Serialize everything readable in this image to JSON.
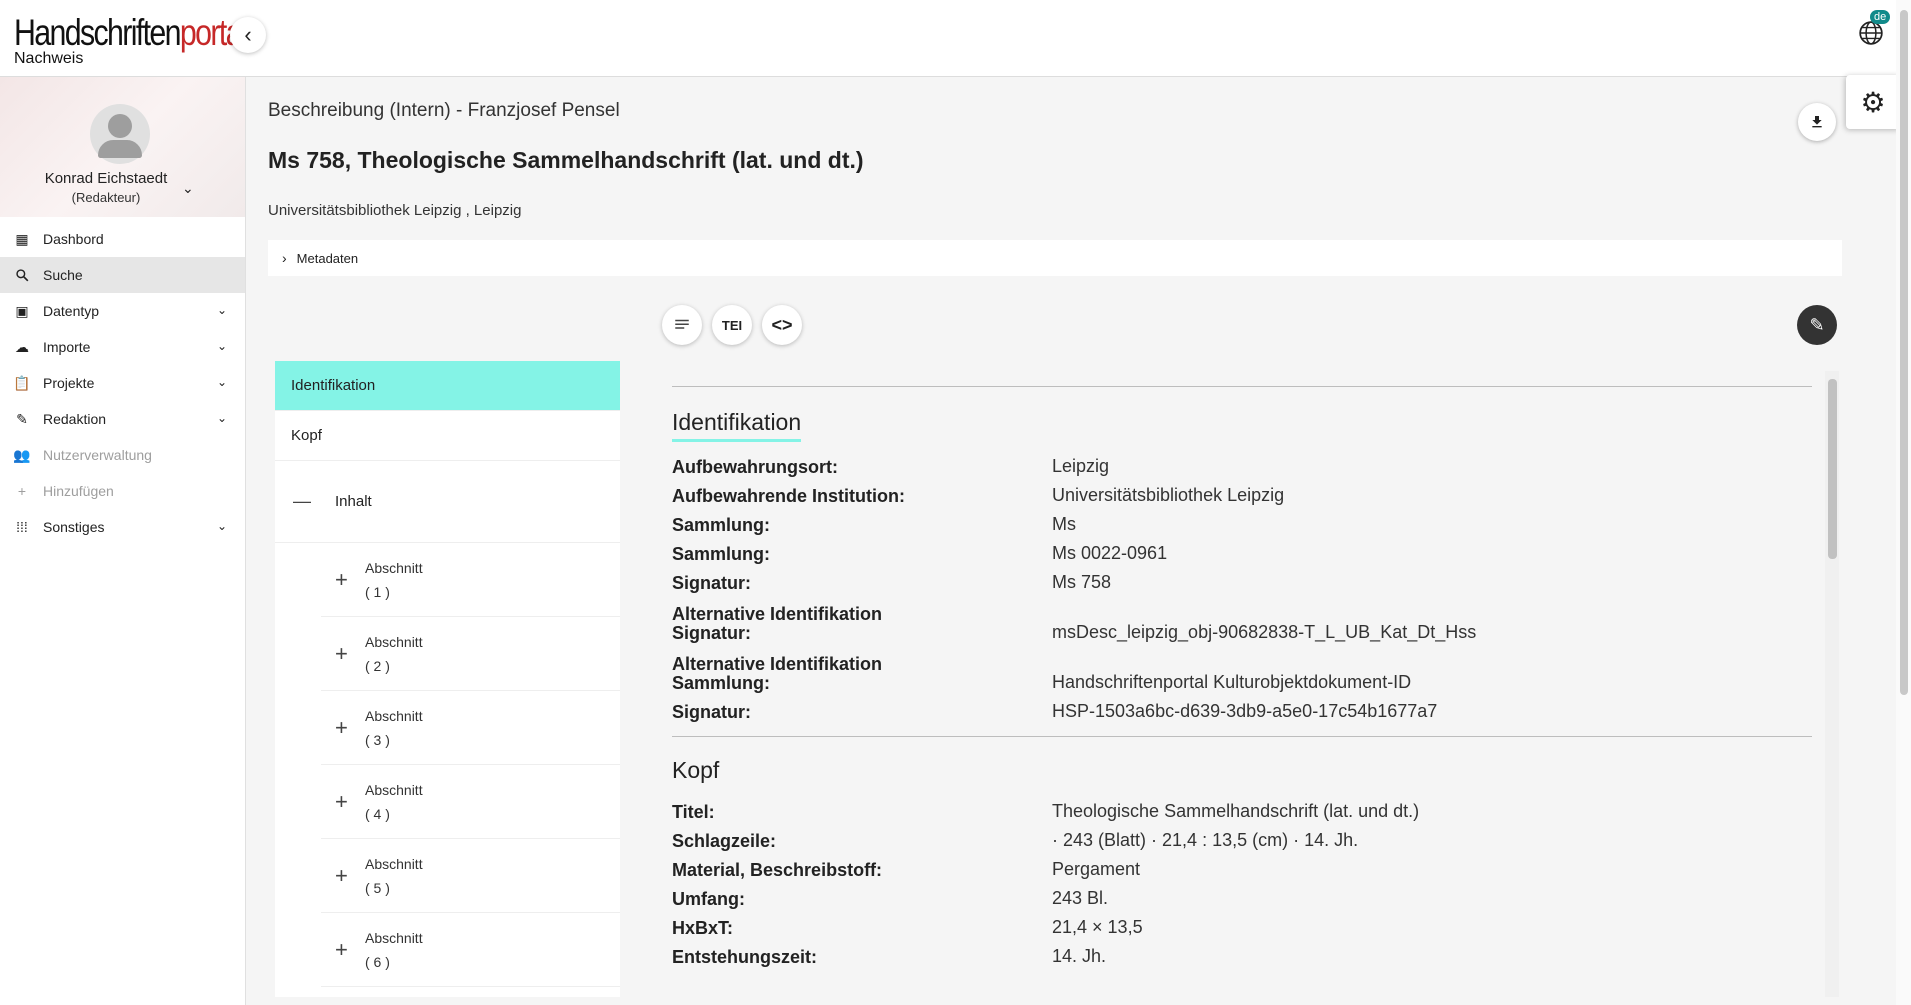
{
  "app": {
    "logo_main_a": "Handschriften",
    "logo_main_b": "portal",
    "logo_sub": "Nachweis",
    "language": "de"
  },
  "user": {
    "name": "Konrad Eichstaedt",
    "role": "(Redakteur)"
  },
  "sidebar": {
    "items": [
      {
        "label": "Dashbord",
        "icon": "dashboard-icon"
      },
      {
        "label": "Suche",
        "icon": "search-icon"
      },
      {
        "label": "Datentyp",
        "icon": "datatype-icon"
      },
      {
        "label": "Importe",
        "icon": "cloud-icon"
      },
      {
        "label": "Projekte",
        "icon": "clipboard-icon"
      },
      {
        "label": "Redaktion",
        "icon": "pencil-icon"
      },
      {
        "label": "Nutzerverwaltung",
        "icon": "users-icon"
      },
      {
        "label": "Hinzufügen",
        "icon": "plus-icon"
      },
      {
        "label": "Sonstiges",
        "icon": "apps-icon"
      }
    ]
  },
  "header": {
    "breadcrumb": "Beschreibung (Intern) - Franzjosef Pensel",
    "title_shelfmark": "Ms 758",
    "title_rest": ", Theologische Sammelhandschrift (lat. und dt.)",
    "subtitle": "Universitätsbibliothek Leipzig , Leipzig",
    "metadata_label": "Metadaten"
  },
  "toolbar": {
    "tei_label": "TEI"
  },
  "toc": {
    "items": [
      "Identifikation",
      "Kopf",
      "Inhalt"
    ],
    "sub_label": "Abschnitt",
    "subs": [
      "( 1 )",
      "( 2 )",
      "( 3 )",
      "( 4 )",
      "( 5 )",
      "( 6 )"
    ]
  },
  "content": {
    "identifikation": {
      "title": "Identifikation",
      "rows": [
        {
          "k": "Aufbewahrungsort:",
          "v": "Leipzig"
        },
        {
          "k": "Aufbewahrende Institution:",
          "v": "Universitätsbibliothek Leipzig"
        },
        {
          "k": "Sammlung:",
          "v": "Ms"
        },
        {
          "k": "Sammlung:",
          "v": "Ms 0022-0961"
        },
        {
          "k": "Signatur:",
          "v": "Ms 758"
        },
        {
          "k1": "Alternative Identifikation",
          "k2": "Signatur:",
          "v": "msDesc_leipzig_obj-90682838-T_L_UB_Kat_Dt_Hss"
        },
        {
          "k1": "Alternative Identifikation",
          "k2": "Sammlung:",
          "v": "Handschriftenportal Kulturobjektdokument-ID"
        },
        {
          "k": "Signatur:",
          "v": "HSP-1503a6bc-d639-3db9-a5e0-17c54b1677a7"
        }
      ]
    },
    "kopf": {
      "title": "Kopf",
      "rows": [
        {
          "k": "Titel:",
          "v": "Theologische Sammelhandschrift (lat. und dt.)"
        },
        {
          "k": "Schlagzeile:",
          "v": "· 243 (Blatt) · 21,4 : 13,5 (cm) · 14. Jh."
        },
        {
          "k": "Material, Beschreibstoff:",
          "v": "Pergament"
        },
        {
          "k": "Umfang:",
          "v": "243 Bl."
        },
        {
          "k": "HxBxT:",
          "v": "21,4 × 13,5"
        },
        {
          "k": "Entstehungszeit:",
          "v": "14. Jh."
        }
      ]
    }
  }
}
